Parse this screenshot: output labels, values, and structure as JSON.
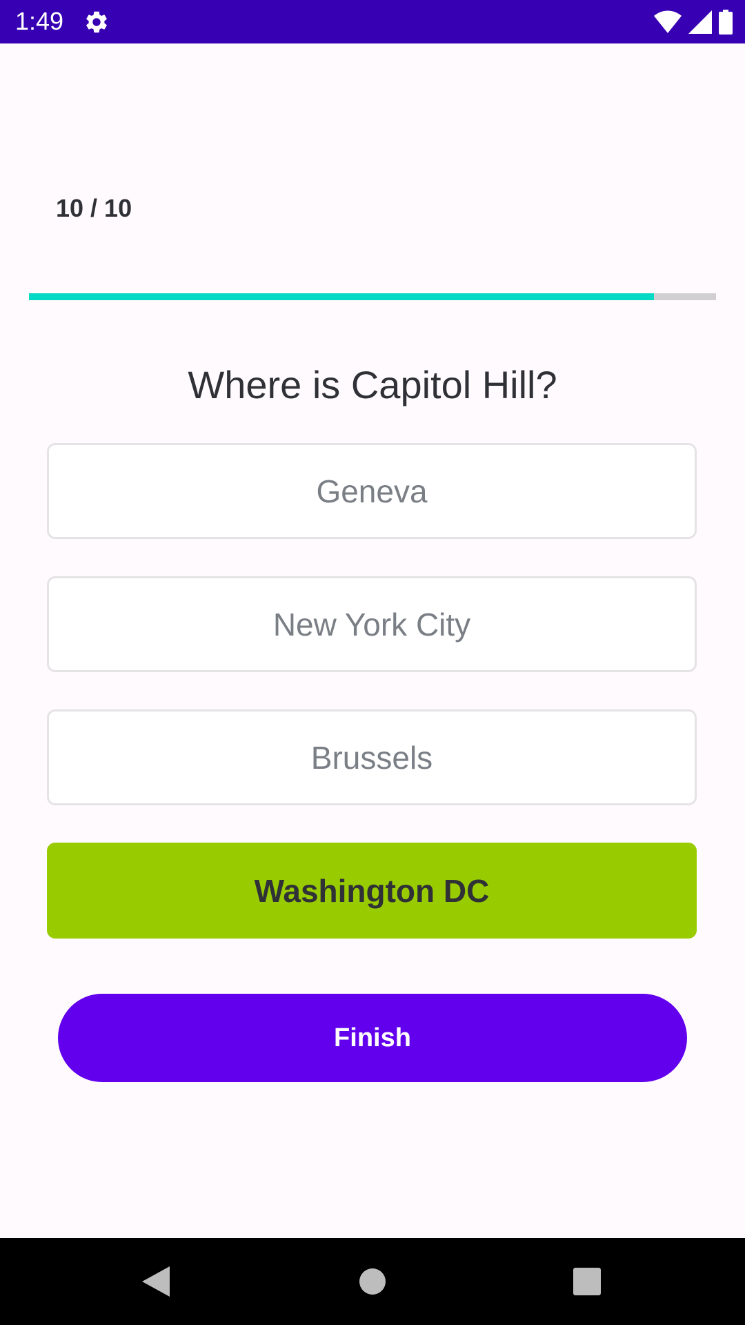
{
  "status_bar": {
    "time": "1:49",
    "icons": [
      "settings-icon",
      "wifi-icon",
      "signal-icon",
      "battery-icon"
    ],
    "background": "#3700B3"
  },
  "quiz": {
    "counter": "10 / 10",
    "progress_fraction": 0.91,
    "progress_color": "#03DAC5",
    "question": "Where is Capitol Hill?",
    "options": [
      {
        "label": "Geneva",
        "state": "default"
      },
      {
        "label": "New York City",
        "state": "default"
      },
      {
        "label": "Brussels",
        "state": "default"
      },
      {
        "label": "Washington DC",
        "state": "correct"
      }
    ],
    "correct_color": "#99CC00",
    "finish_label": "Finish",
    "finish_color": "#6200EE"
  },
  "nav_bar": {
    "icons": [
      "back-icon",
      "home-icon",
      "recents-icon"
    ]
  }
}
